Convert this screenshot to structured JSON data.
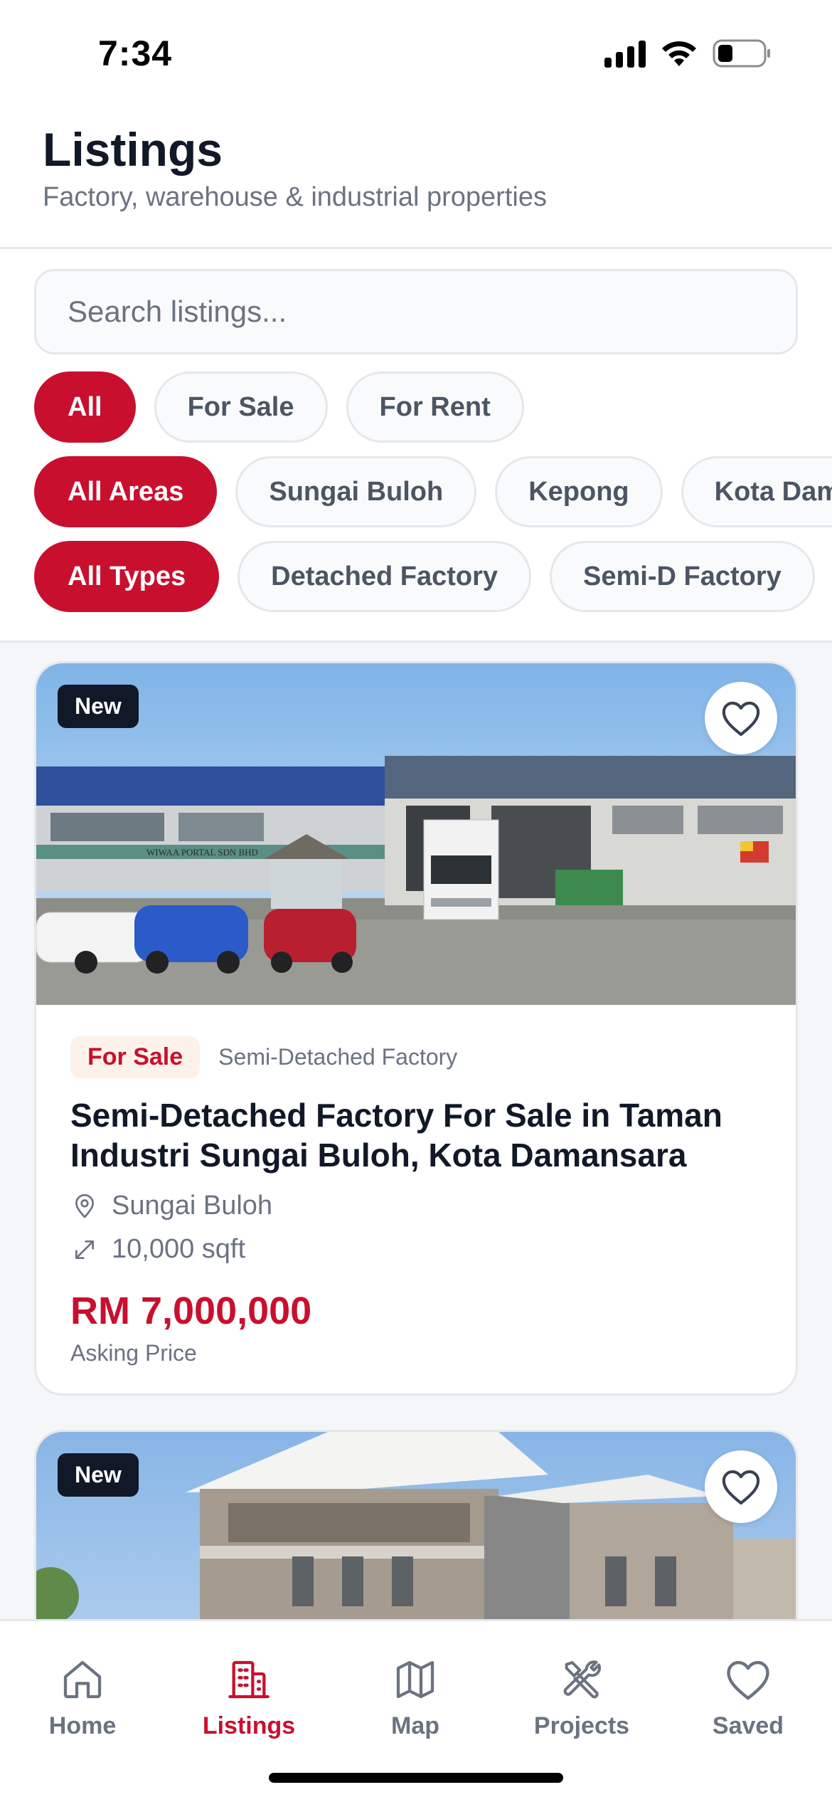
{
  "status_bar": {
    "time": "7:34"
  },
  "header": {
    "title": "Listings",
    "subtitle": "Factory, warehouse & industrial properties"
  },
  "search": {
    "placeholder": "Search listings..."
  },
  "filters": {
    "listing_type": [
      {
        "label": "All",
        "active": true
      },
      {
        "label": "For Sale",
        "active": false
      },
      {
        "label": "For Rent",
        "active": false
      }
    ],
    "areas": [
      {
        "label": "All Areas",
        "active": true
      },
      {
        "label": "Sungai Buloh",
        "active": false
      },
      {
        "label": "Kepong",
        "active": false
      },
      {
        "label": "Kota Damansara",
        "active": false
      }
    ],
    "property_types": [
      {
        "label": "All Types",
        "active": true
      },
      {
        "label": "Detached Factory",
        "active": false
      },
      {
        "label": "Semi-D Factory",
        "active": false
      }
    ]
  },
  "listings": [
    {
      "badge": "New",
      "favorite_icon": "heart-outline-icon",
      "status_tag": "For Sale",
      "property_type": "Semi-Detached Factory",
      "title": "Semi-Detached Factory For Sale in Taman Industri Sungai Buloh, Kota Damansara",
      "location": "Sungai Buloh",
      "size": "10,000 sqft",
      "price": "RM 7,000,000",
      "price_label": "Asking Price",
      "signage_text": "WIWAA PORTAL SDN BHD"
    },
    {
      "badge": "New",
      "favorite_icon": "heart-outline-icon"
    }
  ],
  "tab_bar": {
    "tabs": [
      {
        "label": "Home",
        "icon": "home-icon",
        "active": false
      },
      {
        "label": "Listings",
        "icon": "building-icon",
        "active": true
      },
      {
        "label": "Map",
        "icon": "map-icon",
        "active": false
      },
      {
        "label": "Projects",
        "icon": "tools-icon",
        "active": false
      },
      {
        "label": "Saved",
        "icon": "heart-icon",
        "active": false
      }
    ]
  },
  "colors": {
    "brand": "#c8102e",
    "text_primary": "#111827",
    "text_secondary": "#6b7280",
    "border": "#e5e7eb",
    "feed_background": "#f5f6f8"
  }
}
